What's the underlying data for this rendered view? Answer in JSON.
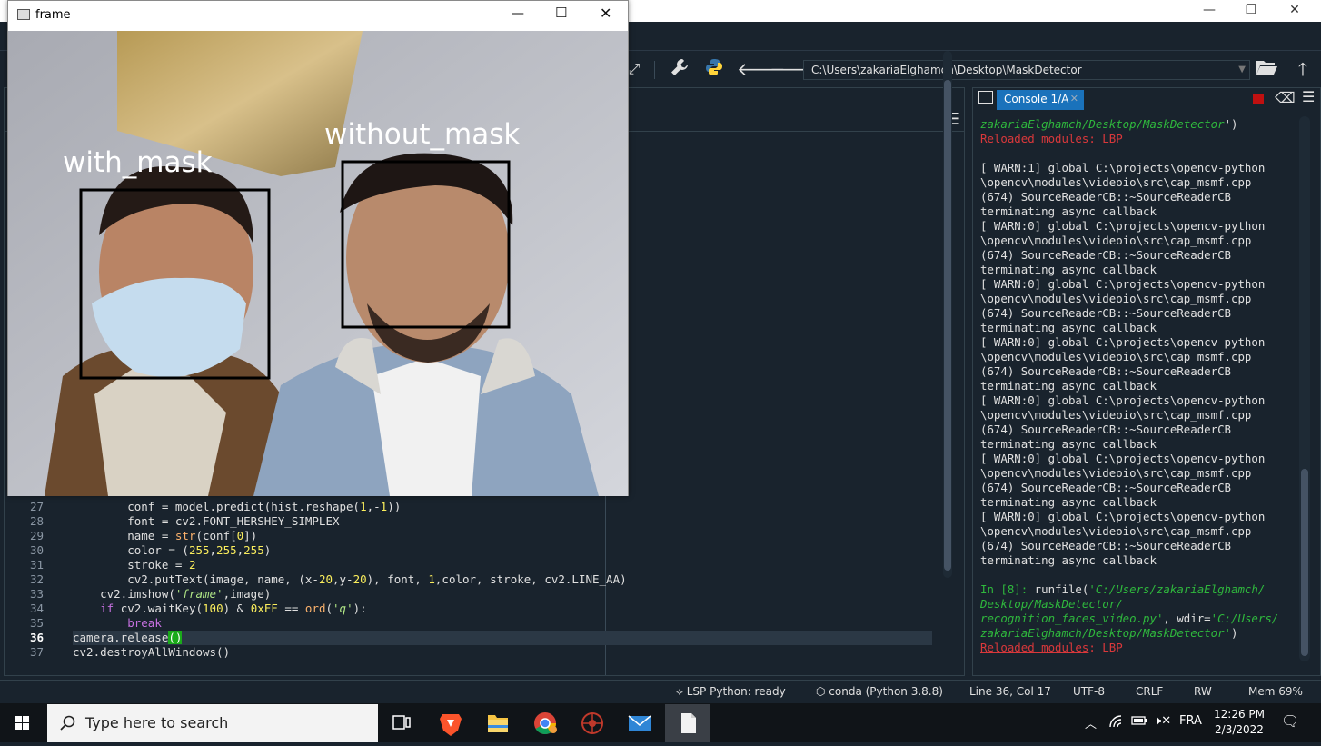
{
  "frame_window": {
    "title": "frame",
    "labels": [
      "with_mask",
      "without_mask"
    ]
  },
  "toolbar": {
    "path": "C:\\Users\\zakariaElghamch\\Desktop\\MaskDetector"
  },
  "editor": {
    "lines": [
      {
        "num": "27",
        "current": false
      },
      {
        "num": "28",
        "current": false
      },
      {
        "num": "29",
        "current": false
      },
      {
        "num": "30",
        "current": false
      },
      {
        "num": "31",
        "current": false
      },
      {
        "num": "32",
        "current": false
      },
      {
        "num": "33",
        "current": false
      },
      {
        "num": "34",
        "current": false
      },
      {
        "num": "35",
        "current": false
      },
      {
        "num": "36",
        "current": true
      },
      {
        "num": "37",
        "current": false
      }
    ],
    "code": {
      "l27": {
        "a": "        conf = model.predict(hist.reshape(",
        "b": "1",
        "c": ",-",
        "d": "1",
        "e": "))"
      },
      "l28": "        font = cv2.FONT_HERSHEY_SIMPLEX",
      "l29": {
        "a": "        name = ",
        "b": "str",
        "c": "(conf[",
        "d": "0",
        "e": "])"
      },
      "l30": {
        "a": "        color = (",
        "b": "255",
        "c": ",",
        "d": "255",
        "e": ",",
        "f": "255",
        "g": ")"
      },
      "l31": {
        "a": "        stroke = ",
        "b": "2"
      },
      "l32": {
        "a": "        cv2.putText(image, name, (x-",
        "b": "20",
        "c": ",y-",
        "d": "20",
        "e": "), font, ",
        "f": "1",
        "g": ",color, stroke, cv2.LINE_AA)"
      },
      "l33": {
        "a": "    cv2.imshow(",
        "b": "'frame'",
        "c": ",image)"
      },
      "l34": {
        "a": "    ",
        "b": "if",
        "c": " cv2.waitKey(",
        "d": "100",
        "e": ") & ",
        "f": "0xFF",
        "g": " == ",
        "h": "ord",
        "i": "(",
        "j": "'q'",
        "k": "):"
      },
      "l35": {
        "a": "        ",
        "b": "break"
      },
      "l36": {
        "a": "camera.release",
        "b": "()"
      },
      "l37": "cv2.destroyAllWindows()"
    }
  },
  "console": {
    "tab_label": "Console 1/A",
    "top_path": "zakariaElghamch/Desktop/MaskDetector",
    "top_path_end": "')",
    "reloaded": "Reloaded modules",
    "reloaded_val": ": LBP",
    "warns": [
      [
        "[ WARN:1] global C:\\projects\\opencv-python",
        "\\opencv\\modules\\videoio\\src\\cap_msmf.cpp",
        "(674) SourceReaderCB::~SourceReaderCB",
        "terminating async callback"
      ],
      [
        "[ WARN:0] global C:\\projects\\opencv-python",
        "\\opencv\\modules\\videoio\\src\\cap_msmf.cpp",
        "(674) SourceReaderCB::~SourceReaderCB",
        "terminating async callback"
      ],
      [
        "[ WARN:0] global C:\\projects\\opencv-python",
        "\\opencv\\modules\\videoio\\src\\cap_msmf.cpp",
        "(674) SourceReaderCB::~SourceReaderCB",
        "terminating async callback"
      ],
      [
        "[ WARN:0] global C:\\projects\\opencv-python",
        "\\opencv\\modules\\videoio\\src\\cap_msmf.cpp",
        "(674) SourceReaderCB::~SourceReaderCB",
        "terminating async callback"
      ],
      [
        "[ WARN:0] global C:\\projects\\opencv-python",
        "\\opencv\\modules\\videoio\\src\\cap_msmf.cpp",
        "(674) SourceReaderCB::~SourceReaderCB",
        "terminating async callback"
      ],
      [
        "[ WARN:0] global C:\\projects\\opencv-python",
        "\\opencv\\modules\\videoio\\src\\cap_msmf.cpp",
        "(674) SourceReaderCB::~SourceReaderCB",
        "terminating async callback"
      ],
      [
        "[ WARN:0] global C:\\projects\\opencv-python",
        "\\opencv\\modules\\videoio\\src\\cap_msmf.cpp",
        "(674) SourceReaderCB::~SourceReaderCB",
        "terminating async callback"
      ]
    ],
    "prompt": "In [8]:",
    "cmd1": " runfile(",
    "cmd2": "'C:/Users/zakariaElghamch/",
    "cmd3": "Desktop/MaskDetector/",
    "cmd4": "recognition_faces_video.py'",
    "cmd5": ", wdir=",
    "cmd6": "'C:/Users/",
    "cmd7": "zakariaElghamch/Desktop/MaskDetector'",
    "cmd8": ")"
  },
  "statusbar": {
    "lsp": "LSP Python: ready",
    "conda": "conda (Python 3.8.8)",
    "position": "Line 36, Col 17",
    "encoding": "UTF-8",
    "eol": "CRLF",
    "permissions": "RW",
    "memory": "Mem 69%"
  },
  "taskbar": {
    "search_placeholder": "Type here to search",
    "language": "FRA",
    "time": "12:26 PM",
    "date": "2/3/2022"
  }
}
